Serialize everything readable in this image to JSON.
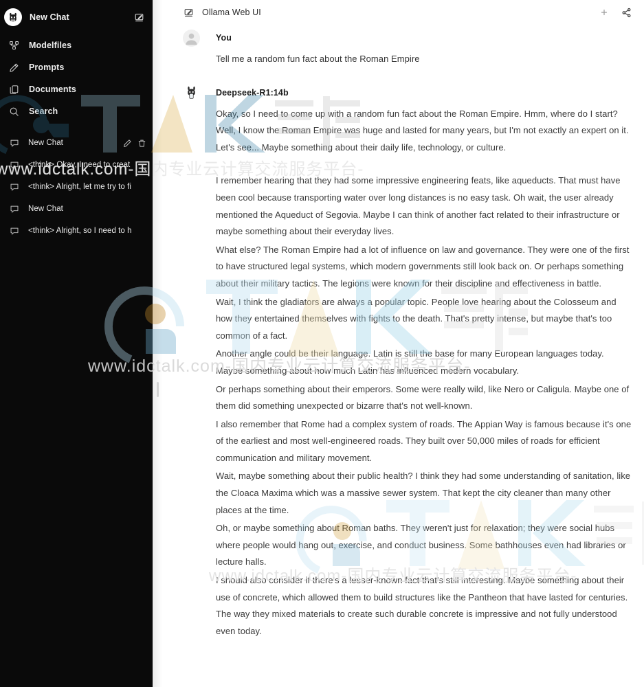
{
  "colors": {
    "sidebar_bg": "#0a0a0a",
    "main_bg": "#ffffff",
    "text_primary": "#1d1d1d",
    "text_body": "#3b3b3b",
    "sidebar_text": "#ededed",
    "watermark_blue": "#a9d6ec",
    "watermark_gold": "#d9a93c",
    "watermark_gray": "#c9c9c9"
  },
  "sidebar": {
    "logo_icon": "ollama-llama-icon",
    "new_chat_label": "New Chat",
    "new_chat_edit_icon": "compose-icon",
    "nav": [
      {
        "icon": "modelfiles-icon",
        "label": "Modelfiles"
      },
      {
        "icon": "pencil-icon",
        "label": "Prompts"
      },
      {
        "icon": "documents-icon",
        "label": "Documents"
      },
      {
        "icon": "search-icon",
        "label": "Search"
      }
    ],
    "chats": [
      {
        "icon": "chat-bubble-icon",
        "label": "New Chat",
        "active": true,
        "edit_icon": "pencil-icon",
        "delete_icon": "trash-icon"
      },
      {
        "icon": "chat-bubble-icon",
        "label": "<think> Okay, I need to creat",
        "active": false
      },
      {
        "icon": "chat-bubble-icon",
        "label": "<think> Alright, let me try to fi",
        "active": false
      },
      {
        "icon": "chat-bubble-icon",
        "label": "New Chat",
        "active": false
      },
      {
        "icon": "chat-bubble-icon",
        "label": "<think> Alright, so I need to h",
        "active": false
      }
    ]
  },
  "topbar": {
    "edit_icon": "compose-icon",
    "title": "Ollama Web UI",
    "add_icon": "plus-icon",
    "share_icon": "share-icon"
  },
  "conversation": {
    "user": {
      "avatar_icon": "user-avatar-icon",
      "author": "You",
      "text": "Tell me a random fun fact about the Roman Empire"
    },
    "assistant": {
      "avatar_icon": "ollama-llama-icon",
      "author": "Deepseek-R1:14b",
      "paragraphs": [
        "Okay, so I need to come up with a random fun fact about the Roman Empire. Hmm, where do I start? Well, I know the Roman Empire was huge and lasted for many years, but I'm not exactly an expert on it. Let's see... Maybe something about their daily life, technology, or culture.",
        "I remember hearing that they had some impressive engineering feats, like aqueducts. That must have been cool because transporting water over long distances is no easy task. Oh wait, the user already mentioned the Aqueduct of Segovia. Maybe I can think of another fact related to their infrastructure or maybe something about their everyday lives.",
        "What else? The Roman Empire had a lot of influence on law and governance. They were one of the first to have structured legal systems, which modern governments still look back on. Or perhaps something about their military tactics. The legions were known for their discipline and effectiveness in battle.",
        "Wait, I think the gladiators are always a popular topic. People love hearing about the Colosseum and how they entertained themselves with fights to the death. That's pretty intense, but maybe that's too common of a fact.",
        "Another angle could be their language. Latin is still the base for many European languages today. Maybe something about how much Latin has influenced modern vocabulary.",
        "Or perhaps something about their emperors. Some were really wild, like Nero or Caligula. Maybe one of them did something unexpected or bizarre that's not well-known.",
        "I also remember that Rome had a complex system of roads. The Appian Way is famous because it's one of the earliest and most well-engineered roads. They built over 50,000 miles of roads for efficient communication and military movement.",
        "Wait, maybe something about their public health? I think they had some understanding of sanitation, like the Cloaca Maxima which was a massive sewer system. That kept the city cleaner than many other places at the time.",
        "Oh, or maybe something about Roman baths. They weren't just for relaxation; they were social hubs where people would hang out, exercise, and conduct business. Some bathhouses even had libraries or lecture halls.",
        "I should also consider if there's a lesser-known fact that's still interesting. Maybe something about their use of concrete, which allowed them to build structures like the Pantheon that have lasted for centuries. The way they mixed materials to create such durable concrete is impressive and not fully understood even today."
      ]
    }
  },
  "watermarks": {
    "brand_text": "IDCTALK",
    "brand_cn": "云说",
    "url_text": "www.idctalk.com-国内专业云计算交流服务平台-"
  }
}
